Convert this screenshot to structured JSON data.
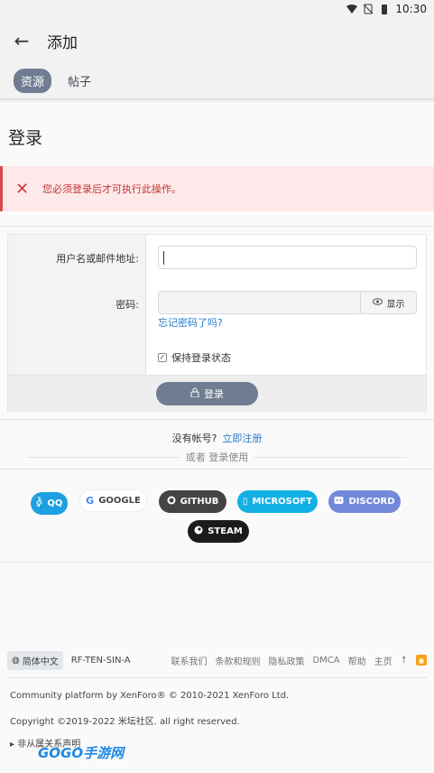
{
  "status": {
    "time": "10:30"
  },
  "appbar": {
    "title": "添加"
  },
  "tabs": [
    {
      "label": "资源"
    },
    {
      "label": "帖子"
    }
  ],
  "page": {
    "title": "登录"
  },
  "error": {
    "message": "您必须登录后才可执行此操作。"
  },
  "form": {
    "username_label": "用户名或邮件地址:",
    "username_value": "",
    "password_label": "密码:",
    "show_label": "显示",
    "forgot_link": "忘记密码了吗?",
    "remember_label": "保持登录状态",
    "login_button": "登录"
  },
  "register": {
    "prompt": "没有帐号?",
    "link": "立即注册"
  },
  "or_login": "或者 登录使用",
  "social": {
    "qq": "QQ",
    "google": "GOOGLE",
    "github": "GITHUB",
    "microsoft": "MICROSOFT",
    "discord": "DISCORD",
    "steam": "STEAM"
  },
  "footer": {
    "language": "简体中文",
    "style": "RF-TEN-SIN-A",
    "links": [
      "联系我们",
      "条款和规则",
      "隐私政策",
      "DMCA",
      "帮助",
      "主页"
    ],
    "copyright1": "Community platform by XenForo® © 2010-2021 XenForo Ltd.",
    "copyright2": "Copyright ©2019-2022 米坛社区. all right reserved.",
    "disclaimer": "非从属关系声明"
  },
  "watermark": "GOGO手游网",
  "colors": {
    "accent": "#6f7c91",
    "link": "#2b7bc9",
    "error": "#d23a3a"
  }
}
